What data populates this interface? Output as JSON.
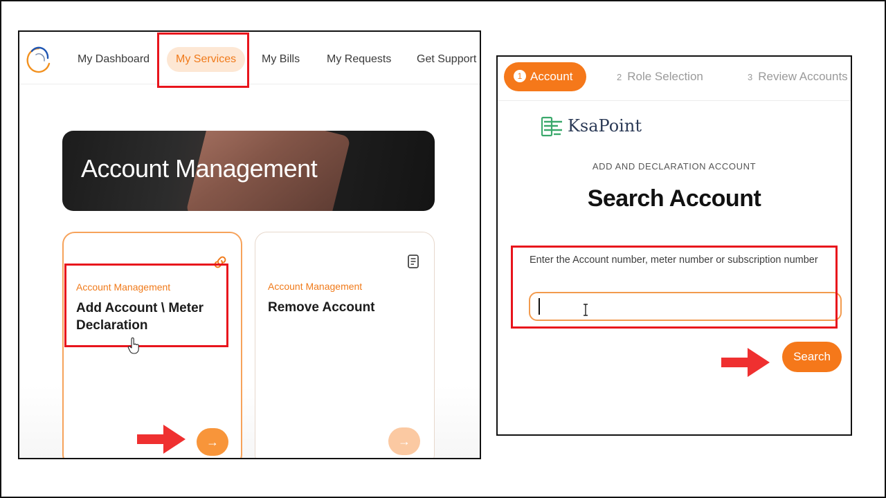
{
  "nav": {
    "items": [
      {
        "label": "My Dashboard"
      },
      {
        "label": "My Services"
      },
      {
        "label": "My Bills"
      },
      {
        "label": "My Requests"
      },
      {
        "label": "Get Support"
      }
    ],
    "active_item": "My Services"
  },
  "banner": {
    "title": "Account Management"
  },
  "cards": [
    {
      "category": "Account Management",
      "title": "Add Account \\ Meter Declaration",
      "icon": "link-icon",
      "action_icon": "arrow-right-icon"
    },
    {
      "category": "Account Management",
      "title": "Remove Account",
      "icon": "document-icon",
      "action_icon": "arrow-right-icon"
    }
  ],
  "steps": [
    {
      "number": "1",
      "label": "Account"
    },
    {
      "number": "2",
      "label": "Role Selection"
    },
    {
      "number": "3",
      "label": "Review Accounts"
    }
  ],
  "active_step": "1",
  "brand": {
    "name": "KsaPoint"
  },
  "form": {
    "eyebrow": "ADD AND DECLARATION ACCOUNT",
    "heading": "Search Account",
    "field_label": "Enter the Account number, meter number or subscription number",
    "input_value": "",
    "search_label": "Search"
  },
  "colors": {
    "accent": "#f5781a",
    "accent_soft": "#fde7d4",
    "highlight": "#e8141c",
    "brand_green": "#3aa86b",
    "brand_navy": "#2b3a56"
  }
}
